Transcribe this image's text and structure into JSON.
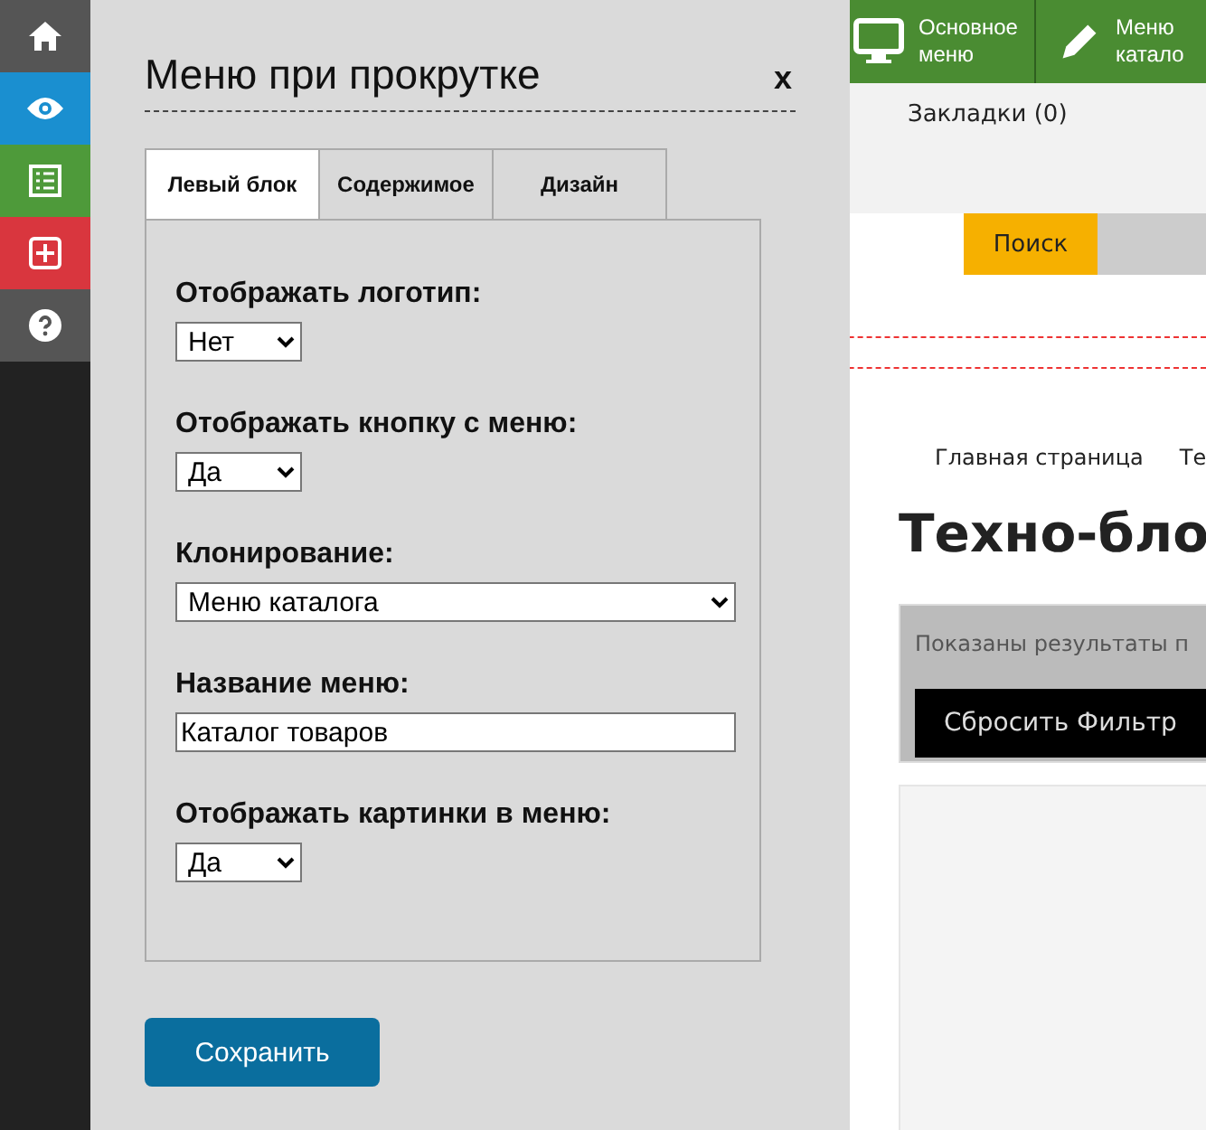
{
  "sidebar": {
    "items": [
      {
        "kind": "home",
        "color": "#555555"
      },
      {
        "kind": "eye",
        "color": "#1a8fd0"
      },
      {
        "kind": "list",
        "color": "#4e9a3a"
      },
      {
        "kind": "plus",
        "color": "#d9363e"
      },
      {
        "kind": "help",
        "color": "#555555"
      }
    ]
  },
  "toolbar": {
    "items": [
      {
        "kind": "monitor",
        "lines": [
          "Основное",
          "меню"
        ]
      },
      {
        "kind": "pencil",
        "lines": [
          "Меню",
          "катало"
        ]
      }
    ]
  },
  "page": {
    "nav": [
      "Закладки (0)"
    ],
    "search": {
      "button": "Поиск"
    },
    "breadcrumbs": [
      "Главная страница",
      "Те"
    ],
    "heading": "Техно-бло",
    "filter_text": "Показаны результаты п",
    "reset_button": "Сбросить Фильтр"
  },
  "dialog": {
    "title": "Меню при прокрутке",
    "close": "x",
    "tabs": [
      {
        "label": "Левый блок",
        "selected": true
      },
      {
        "label": "Содержимое",
        "selected": false
      },
      {
        "label": "Дизайн",
        "selected": false
      }
    ],
    "fields": [
      {
        "label": "Отображать логотип:",
        "kind": "select",
        "value": "Нет",
        "wide": false
      },
      {
        "label": "Отображать кнопку с меню:",
        "kind": "select",
        "value": "Да",
        "wide": false
      },
      {
        "label": "Клонирование:",
        "kind": "select",
        "value": "Меню каталога",
        "wide": true
      },
      {
        "label": "Название меню:",
        "kind": "text",
        "value": "Каталог товаров",
        "wide": true
      },
      {
        "label": "Отображать картинки в меню:",
        "kind": "select",
        "value": "Да",
        "wide": false
      }
    ],
    "save_button": "Сохранить"
  }
}
